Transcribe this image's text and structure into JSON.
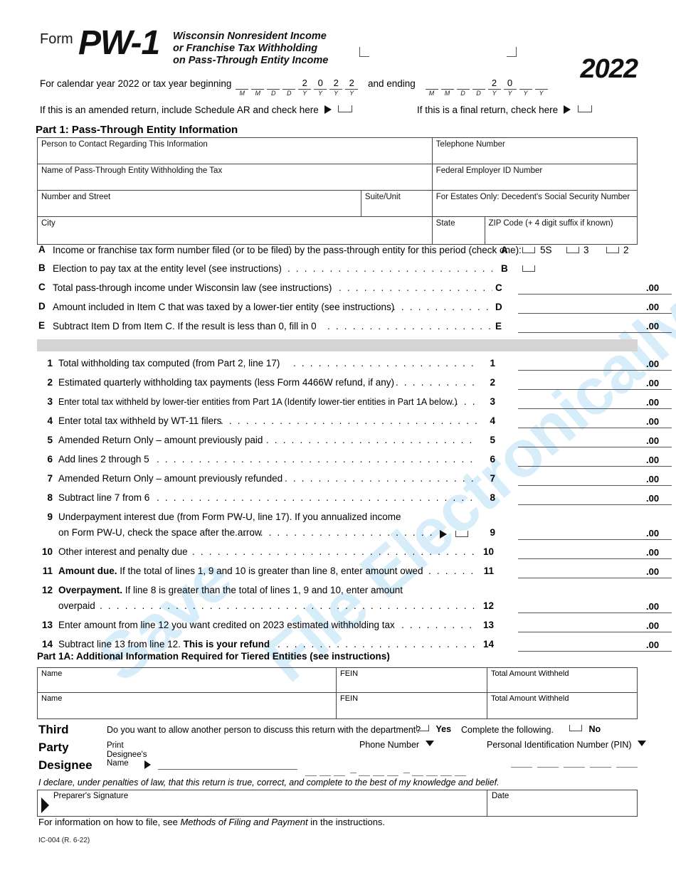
{
  "header": {
    "form_label": "Form",
    "form_number": "PW-1",
    "title_line1": "Wisconsin Nonresident Income",
    "title_line2": "or Franchise Tax Withholding",
    "title_line3": "on Pass-Through Entity Income",
    "year": "2022"
  },
  "watermark": {
    "line1": "Save",
    "line2": "File Electronically"
  },
  "calendar_row": {
    "prefix": "For calendar year 2022 or tax year beginning",
    "middle": "and ending",
    "begin_values": [
      "",
      "",
      "",
      "",
      "2",
      "0",
      "2",
      "2"
    ],
    "begin_tags": [
      "M",
      "M",
      "D",
      "D",
      "Y",
      "Y",
      "Y",
      "Y"
    ],
    "end_values": [
      "",
      "",
      "",
      "",
      "2",
      "0",
      "",
      ""
    ],
    "end_tags": [
      "M",
      "M",
      "D",
      "D",
      "Y",
      "Y",
      "Y",
      "Y"
    ]
  },
  "amended_row": {
    "text": "If this is an amended return, include Schedule AR and check here",
    "checkbox_value": ""
  },
  "final_row": {
    "text": "If this is a final return, check here",
    "checkbox_value": ""
  },
  "part1": {
    "heading": "Part 1:  Pass-Through Entity Information",
    "grid": [
      [
        {
          "label": "Person to Contact Regarding This Information",
          "value": ""
        },
        {
          "label": "Telephone Number",
          "value": ""
        }
      ],
      [
        {
          "label": "Name of Pass-Through Entity Withholding the Tax",
          "value": ""
        },
        {
          "label": "Federal Employer ID Number",
          "value": ""
        }
      ],
      [
        {
          "label": "Number and Street",
          "value": ""
        },
        {
          "label": "Suite/Unit",
          "value": ""
        },
        {
          "label": "For Estates Only:  Decedent's Social Security Number",
          "value": ""
        }
      ],
      [
        {
          "label": "City",
          "value": ""
        },
        {
          "label": "State",
          "value": ""
        },
        {
          "label": "ZIP Code (+ 4 digit suffix if known)",
          "value": ""
        }
      ]
    ]
  },
  "items": [
    {
      "letter": "A",
      "text": "Income or franchise tax form number filed (or to be filed) by the pass-through entity for this period (check one):",
      "leader": "",
      "ref": "A",
      "type": "checkboxes",
      "options": [
        "5S",
        "3",
        "2"
      ],
      "value": ""
    },
    {
      "letter": "B",
      "text": "Election to pay tax at the entity level (see instructions)",
      "leader": ". . . . . . . . . . . . . . . . . . . . . . . . . . . . . . . . . . . . . .",
      "ref": "B",
      "type": "checkbox",
      "value": ""
    },
    {
      "letter": "C",
      "text": "Total pass-through income under Wisconsin law (see instructions)",
      "leader": ". . . . . . . . . . . . . . . . . . . . . . . . . .",
      "ref": "C",
      "type": "amount",
      "value": "",
      "cents": ".00"
    },
    {
      "letter": "D",
      "text": "Amount included in Item C that was taxed by a lower-tier entity (see instructions)",
      "leader": ". . . . . . . . . . . . . . . .",
      "ref": "D",
      "type": "amount",
      "value": "",
      "cents": ".00"
    },
    {
      "letter": "E",
      "text": "Subtract Item D from Item C. If the result is less than 0, fill in 0",
      "leader": ". . . . . . . . . . . . . . . . . . . . . . . . . .",
      "ref": "E",
      "type": "amount",
      "value": "",
      "cents": ".00"
    }
  ],
  "lines": [
    {
      "no": "1",
      "text": "Total withholding tax computed (from Part 2, line 17)",
      "leader": ". . . . . . . . . . . . . . . . . . . . . . . . . . . . . . . . . .",
      "ref": "1",
      "value": "",
      "cents": ".00"
    },
    {
      "no": "2",
      "text": "Estimated quarterly withholding tax payments (less Form 4466W refund, if any)",
      "leader": ". . . . . . . . . . . . . .",
      "ref": "2",
      "value": "",
      "cents": ".00"
    },
    {
      "no": "3",
      "text": "Enter total tax withheld by lower-tier entities from Part 1A (Identify lower-tier entities in Part 1A below.)",
      "leader": ". . . .",
      "ref": "3",
      "value": "",
      "cents": ".00"
    },
    {
      "no": "4",
      "text": "Enter total tax withheld by WT-11 filers",
      "leader": ". . . . . . . . . . . . . . . . . . . . . . . . . . . . . . . . . . . . . .",
      "ref": "4",
      "value": "",
      "cents": ".00"
    },
    {
      "no": "5",
      "text": "Amended Return Only – amount previously paid",
      "leader": ". . . . . . . . . . . . . . . . . . . . . . . . . . . . . . . .",
      "ref": "5",
      "value": "",
      "cents": ".00"
    },
    {
      "no": "6",
      "text": "Add lines 2 through 5",
      "leader": ". . . . . . . . . . . . . . . . . . . . . . . . . . . . . . . . . . . . . . . . . . . . . . . . .",
      "ref": "6",
      "value": "",
      "cents": ".00"
    },
    {
      "no": "7",
      "text": "Amended Return Only – amount previously refunded",
      "leader": ". . . . . . . . . . . . . . . . . . . . . . . . . . . .",
      "ref": "7",
      "value": "",
      "cents": ".00"
    },
    {
      "no": "8",
      "text": "Subtract line 7 from 6",
      "leader": ". . . . . . . . . . . . . . . . . . . . . . . . . . . . . . . . . . . . . . . . . . . . . . . .",
      "ref": "8",
      "value": "",
      "cents": ".00"
    },
    {
      "no": "9",
      "text": "Underpayment interest due (from Form PW-U, line 17). If you annualized income",
      "text2": "on Form PW-U, check the space after the arrow",
      "leader": ". . . . . . . . . . . . . . . . . . . . . . . . . . . . . .",
      "ref": "9",
      "value": "",
      "cents": ".00",
      "has_arrow_checkbox": true
    },
    {
      "no": "10",
      "text": "Other interest and penalty due",
      "leader": ". . . . . . . . . . . . . . . . . . . . . . . . . . . . . . . . . . . . . . . . . . . . .",
      "ref": "10",
      "value": "",
      "cents": ".00"
    },
    {
      "no": "11",
      "text_bold": "Amount due.",
      "text": " If the total of lines 1, 9 and 10 is greater than line 8, enter amount owed",
      "leader": ". . . . . . . .",
      "ref": "11",
      "value": "",
      "cents": ".00"
    },
    {
      "no": "12",
      "text_bold": "Overpayment.",
      "text": " If line 8 is greater than the total of lines 1, 9 and 10, enter amount",
      "text2": "overpaid",
      "leader": ". . . . . . . . . . . . . . . . . . . . . . . . . . . . . . . . . . . . . . . . . . . . . . . . . . . . . . .",
      "ref": "12",
      "value": "",
      "cents": ".00"
    },
    {
      "no": "13",
      "text": "Enter amount from line 12 you want credited on 2023 estimated withholding tax",
      "leader": ". . . . . . . . . . . . .",
      "ref": "13",
      "value": "",
      "cents": ".00"
    },
    {
      "no": "14",
      "text": "Subtract line 13 from line 12. ",
      "text_bold_after": "This is your refund",
      "leader": ". . . . . . . . . . . . . . . . . . . . . . . . . . . . . . . . .",
      "ref": "14",
      "value": "",
      "cents": ".00"
    }
  ],
  "part1a": {
    "heading": "Part 1A:  Additional Information Required for Tiered Entities (see instructions)",
    "columns": [
      "Name",
      "FEIN",
      "Total Amount Withheld"
    ],
    "rows": [
      {
        "name": "",
        "fein": "",
        "amount": ""
      },
      {
        "name": "",
        "fein": "",
        "amount": ""
      }
    ]
  },
  "designee": {
    "label_line1": "Third",
    "label_line2": "Party",
    "label_line3": "Designee",
    "question": "Do you want to allow another person to discuss this return with the department?",
    "yes_label": "Yes",
    "yes_value": "",
    "complete_text": "Complete the following.",
    "no_label": "No",
    "no_value": "",
    "print_line1": "Print",
    "print_line2": "Designee's",
    "print_line3": "Name",
    "designee_name_value": "",
    "phone_header": "Phone Number",
    "phone_value": "",
    "pin_header": "Personal Identification Number (PIN)",
    "pin_value": ""
  },
  "declaration": "I declare, under penalties of law, that this return is true, correct, and complete to the best of my knowledge and belief.",
  "preparer": {
    "signature_label": "Preparer's Signature",
    "signature_value": "",
    "date_label": "Date",
    "date_value": ""
  },
  "footer": {
    "info_prefix": "For information on how to file, see ",
    "info_italic": "Methods of Filing and Payment",
    "info_suffix": " in the instructions.",
    "code": "IC-004 (R. 6-22)"
  }
}
